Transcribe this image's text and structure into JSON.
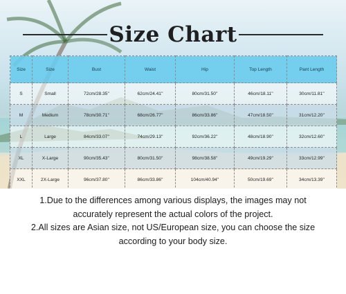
{
  "chart": {
    "title": "Size Chart",
    "headers": [
      "Size",
      "Size",
      "Bust",
      "Waist",
      "Hip",
      "Top Length",
      "Pant Length"
    ],
    "rows": [
      [
        "S",
        "Small",
        "72cm/28.35''",
        "62cm/24.41''",
        "80cm/31.50''",
        "46cm/18.11''",
        "30cm/11.81''"
      ],
      [
        "M",
        "Medium",
        "78cm/30.71''",
        "68cm/26.77''",
        "86cm/33.86''",
        "47cm/18.50''",
        "31cm/12.20''"
      ],
      [
        "L",
        "Large",
        "84cm/33.07''",
        "74cm/29.13''",
        "92cm/36.22''",
        "48cm/18.90''",
        "32cm/12.60''"
      ],
      [
        "XL",
        "X-Large",
        "90cm/35.43''",
        "80cm/31.50''",
        "98cm/38.58''",
        "49cm/19.29''",
        "33cm/12.99''"
      ],
      [
        "XXL",
        "2X-Large",
        "96cm/37.80''",
        "86cm/33.86''",
        "104cm/40.94''",
        "50cm/19.69''",
        "34cm/13.39''"
      ]
    ]
  },
  "notes": {
    "line1": "1.Due to the differences among various displays, the images may not",
    "line2": "accurately represent the actual colors of the project.",
    "line3": "2.All sizes are Asian size, not US/European size, you can choose the size",
    "line4": "according to your body size."
  }
}
